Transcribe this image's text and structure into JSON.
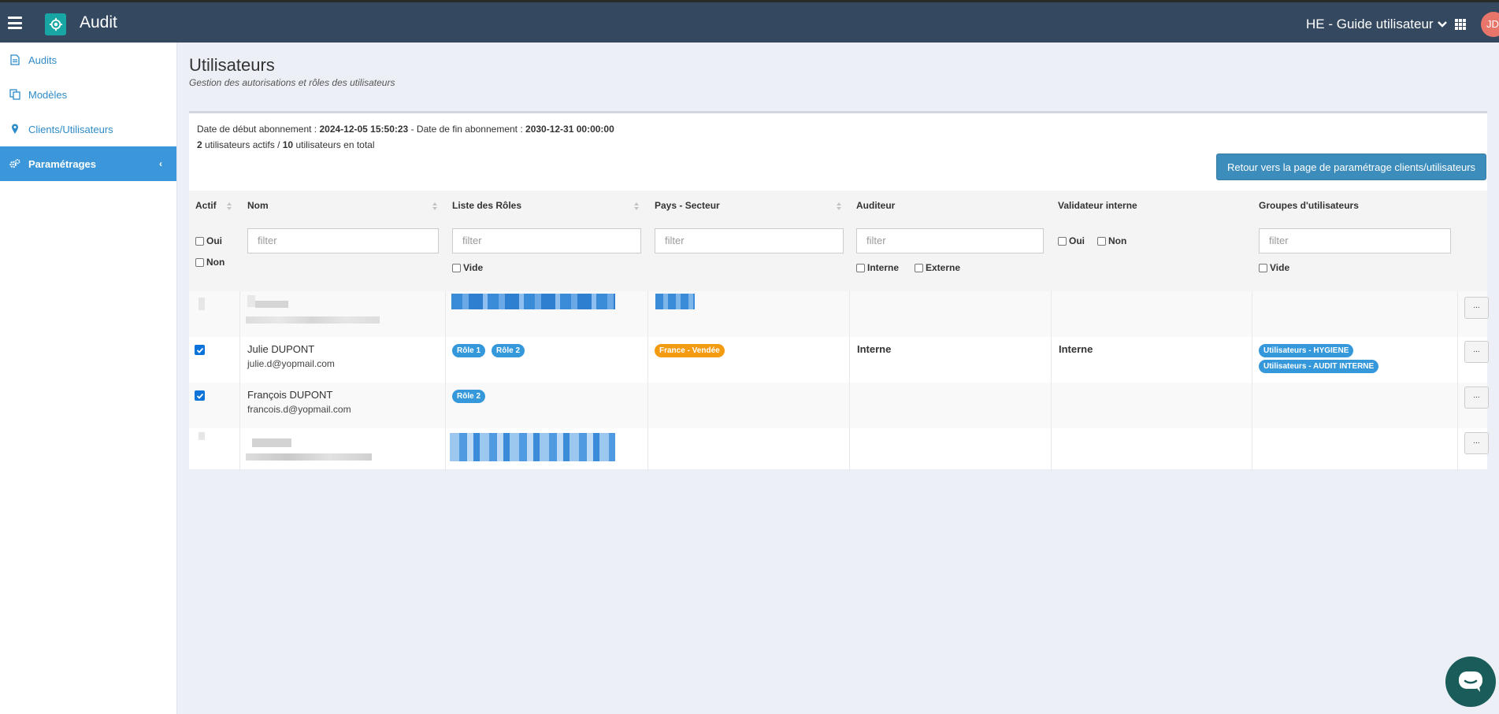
{
  "app": {
    "title": "Audit",
    "organisation": "HE - Guide utilisateur",
    "avatar_initials": "JD"
  },
  "sidebar": {
    "items": [
      {
        "label": "Audits",
        "icon": "document-icon"
      },
      {
        "label": "Modèles",
        "icon": "copy-icon"
      },
      {
        "label": "Clients/Utilisateurs",
        "icon": "map-pin-icon"
      },
      {
        "label": "Paramétrages",
        "icon": "gears-icon",
        "active": true
      }
    ]
  },
  "page": {
    "title": "Utilisateurs",
    "subtitle": "Gestion des autorisations et rôles des utilisateurs"
  },
  "subscription": {
    "start_label": "Date de début abonnement :",
    "start_value": "2024-12-05 15:50:23",
    "end_label": "- Date de fin abonnement :",
    "end_value": "2030-12-31 00:00:00",
    "active_count": "2",
    "active_label": "utilisateurs actifs /",
    "total_count": "10",
    "total_label": "utilisateurs en total"
  },
  "back_button": "Retour vers la page de paramétrage clients/utilisateurs",
  "table": {
    "columns": [
      "Actif",
      "Nom",
      "Liste des Rôles",
      "Pays - Secteur",
      "Auditeur",
      "Validateur interne",
      "Groupes d'utilisateurs"
    ],
    "filter_placeholder": "filter",
    "filters": {
      "oui": "Oui",
      "non": "Non",
      "vide": "Vide",
      "interne": "Interne",
      "externe": "Externe"
    },
    "rows": [
      {
        "name": "Julie DUPONT",
        "email": "julie.d@yopmail.com",
        "roles": [
          "Rôle 1",
          "Rôle 2"
        ],
        "country": "France - Vendée",
        "auditor": "Interne",
        "validator": "Interne",
        "groups": [
          "Utilisateurs - HYGIENE",
          "Utilisateurs - AUDIT INTERNE"
        ]
      },
      {
        "name": "François DUPONT",
        "email": "francois.d@yopmail.com",
        "roles": [
          "Rôle 2"
        ]
      }
    ],
    "more_label": "..."
  },
  "colors": {
    "topbar": "#344960",
    "accent": "#3b97d9",
    "badge_blue": "#3498db",
    "badge_orange": "#f39c12"
  }
}
